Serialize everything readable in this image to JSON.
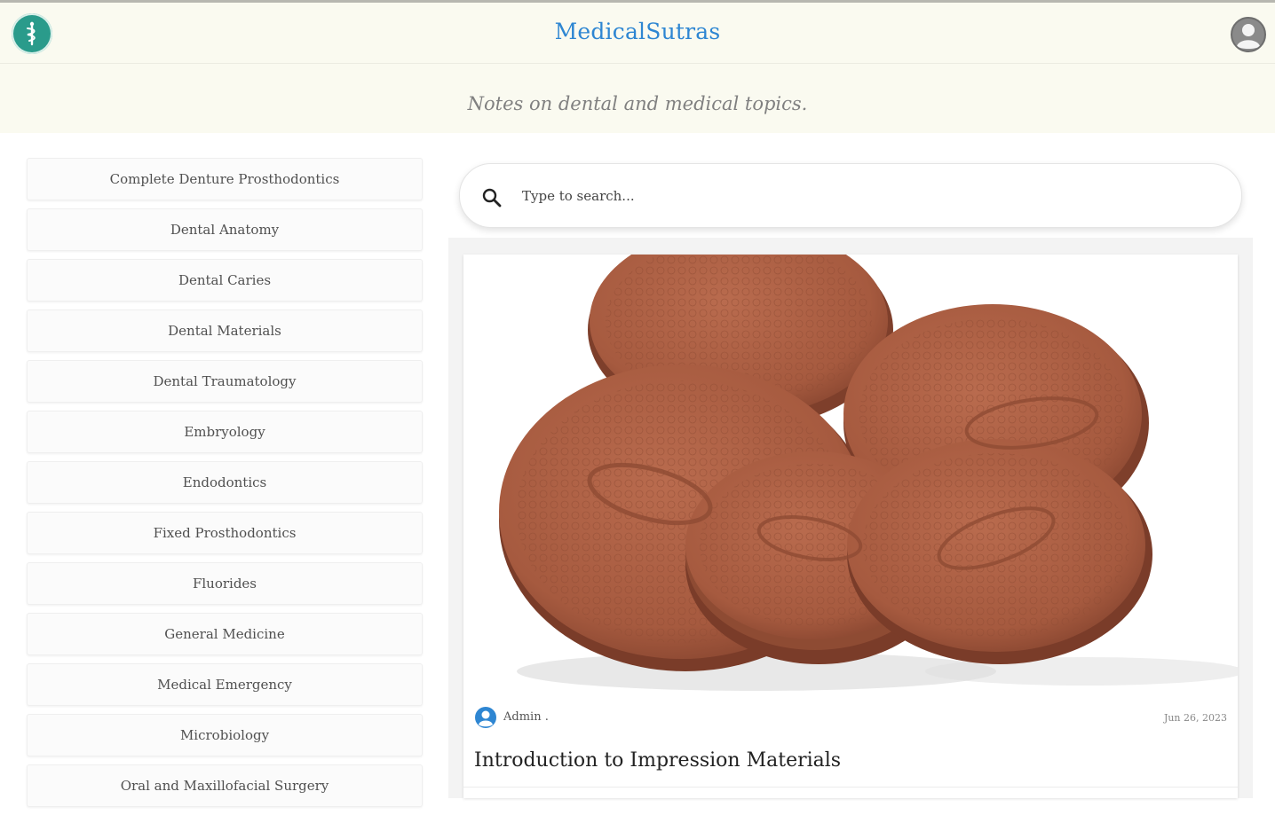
{
  "header": {
    "site_title": "MedicalSutras",
    "logo_icon": "caduceus-icon",
    "account_icon": "user-account-icon",
    "brand_color": "#2e86d2",
    "logo_color": "#2a9b8b"
  },
  "tagline": "Notes on dental and medical topics.",
  "sidebar": {
    "items": [
      {
        "label": "Complete Denture Prosthodontics"
      },
      {
        "label": "Dental Anatomy"
      },
      {
        "label": "Dental Caries"
      },
      {
        "label": "Dental Materials"
      },
      {
        "label": "Dental Traumatology"
      },
      {
        "label": "Embryology"
      },
      {
        "label": "Endodontics"
      },
      {
        "label": "Fixed Prosthodontics"
      },
      {
        "label": "Fluorides"
      },
      {
        "label": "General Medicine"
      },
      {
        "label": "Medical Emergency"
      },
      {
        "label": "Microbiology"
      },
      {
        "label": "Oral and Maxillofacial Surgery"
      }
    ]
  },
  "search": {
    "placeholder": "Type to search...",
    "value": ""
  },
  "post": {
    "image_icon": "impression-compound-discs-image",
    "author": "Admin .",
    "date": "Jun 26, 2023",
    "title": "Introduction to Impression Materials"
  }
}
